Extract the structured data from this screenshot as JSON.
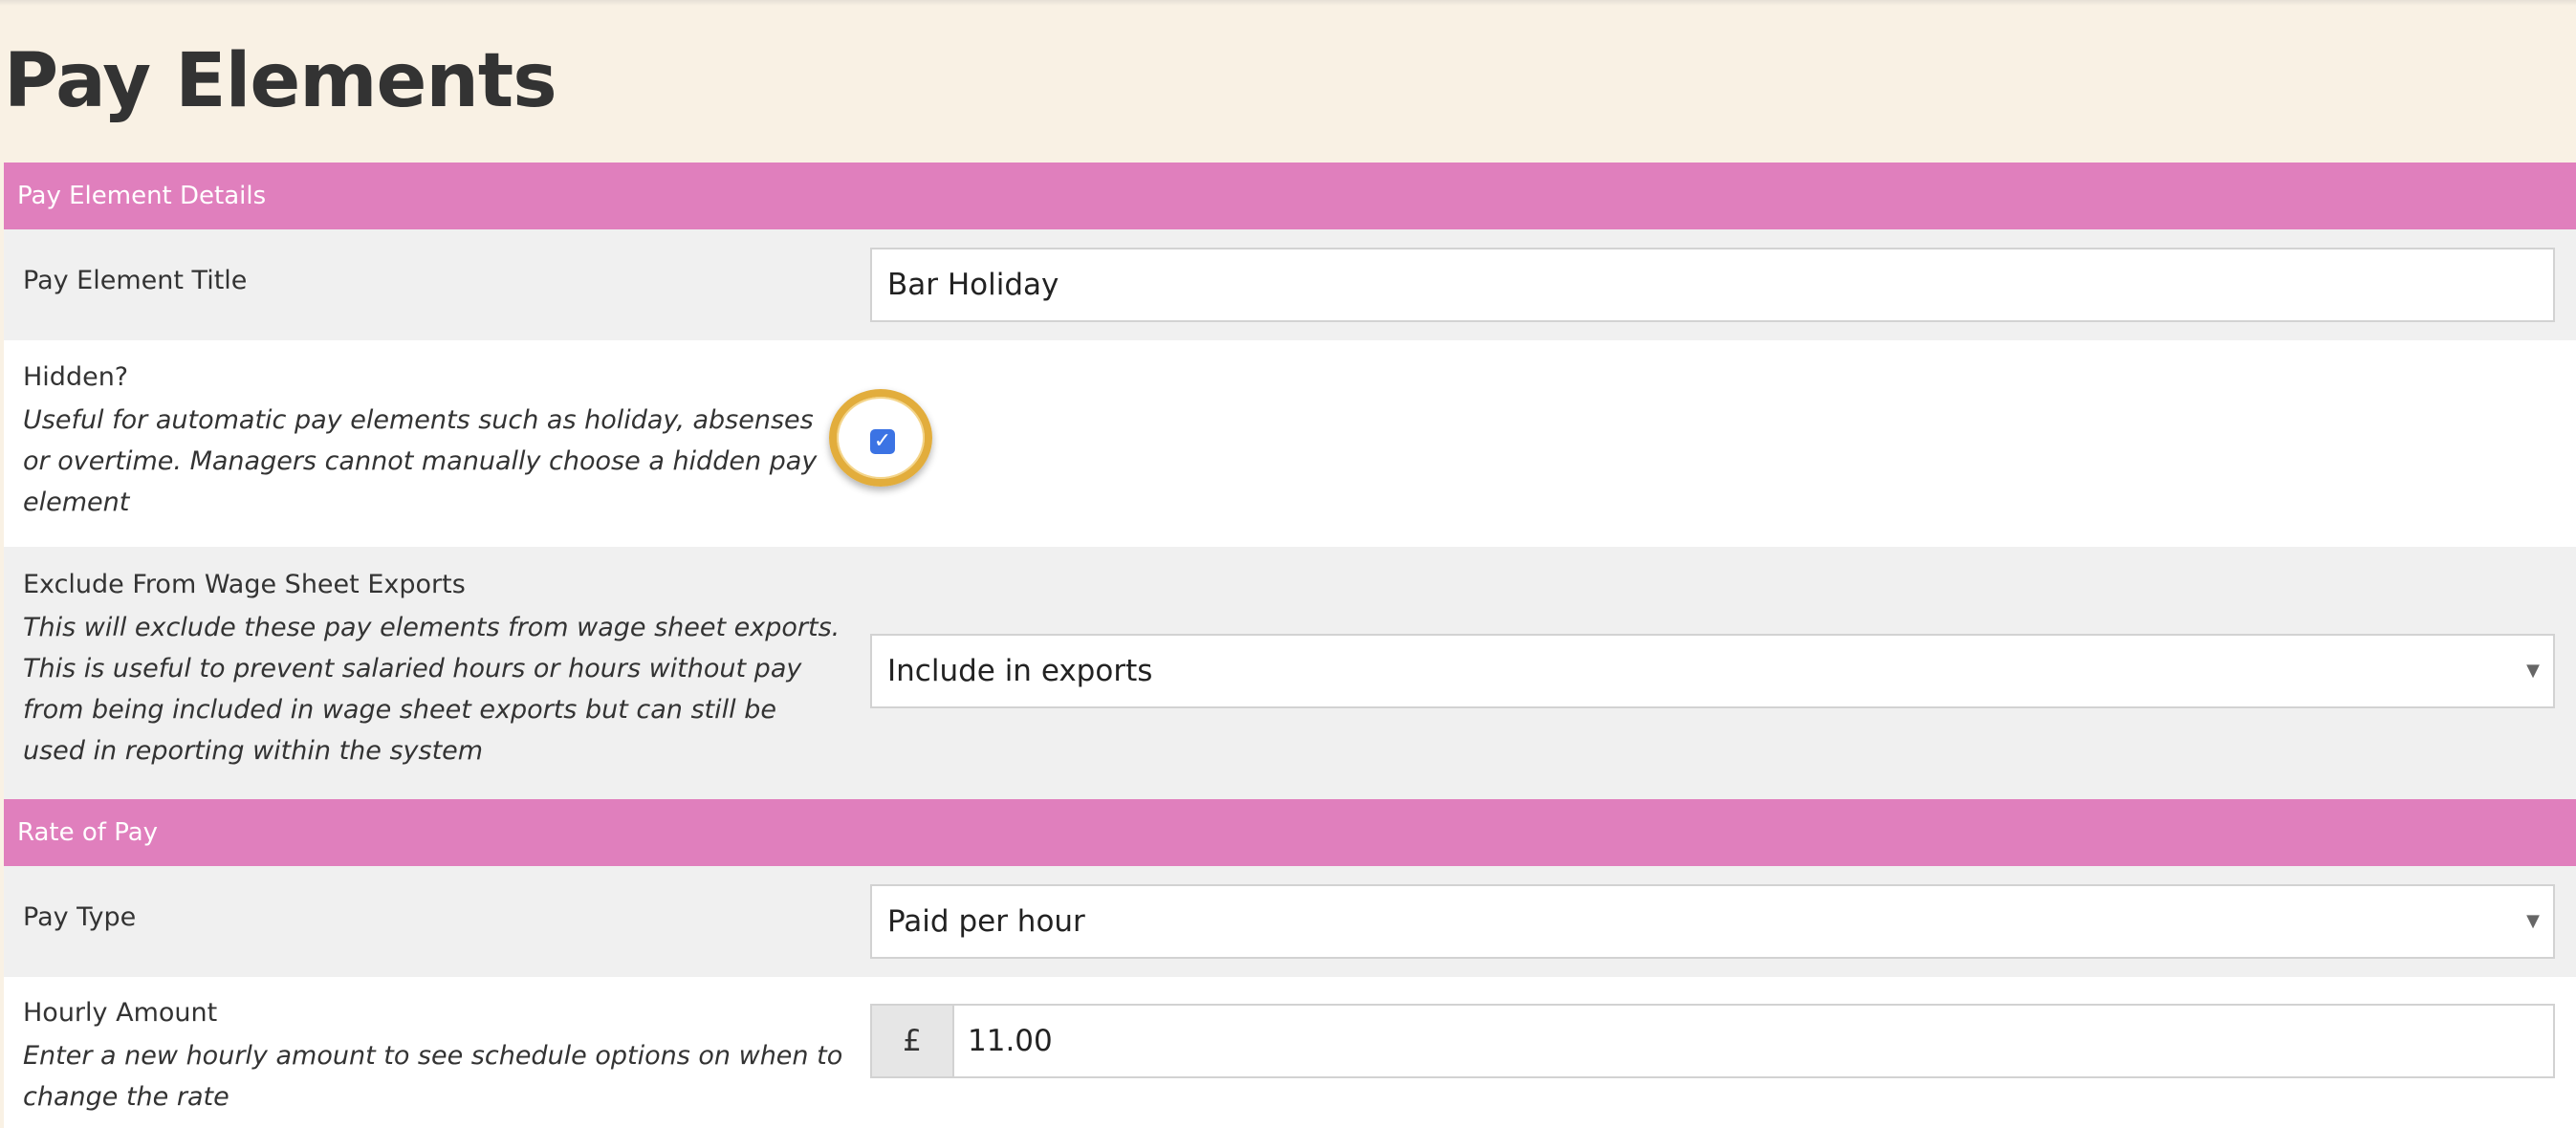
{
  "page": {
    "title": "Pay Elements"
  },
  "sections": {
    "pay_element_details": "Pay Element Details",
    "rate_of_pay": "Rate of Pay"
  },
  "fields": {
    "title": {
      "label": "Pay Element Title",
      "value": "Bar Holiday"
    },
    "hidden": {
      "label": "Hidden?",
      "description": "Useful for automatic pay elements such as holiday, absenses or overtime. Managers cannot manually choose a hidden pay element",
      "checked": true
    },
    "exclude_exports": {
      "label": "Exclude From Wage Sheet Exports",
      "description": "This will exclude these pay elements from wage sheet exports. This is useful to prevent salaried hours or hours without pay from being included in wage sheet exports but can still be used in reporting within the system",
      "value": "Include in exports"
    },
    "pay_type": {
      "label": "Pay Type",
      "value": "Paid per hour"
    },
    "hourly_amount": {
      "label": "Hourly Amount",
      "description": "Enter a new hourly amount to see schedule options on when to change the rate",
      "currency_symbol": "£",
      "value": "11.00"
    }
  },
  "icons": {
    "select_caret": "▼",
    "checkmark": "✓"
  },
  "colors": {
    "section_header": "#e07fbd",
    "page_background": "#f9f1e4",
    "checkbox": "#3b73e4",
    "highlight_ring": "#e2ad3c"
  }
}
